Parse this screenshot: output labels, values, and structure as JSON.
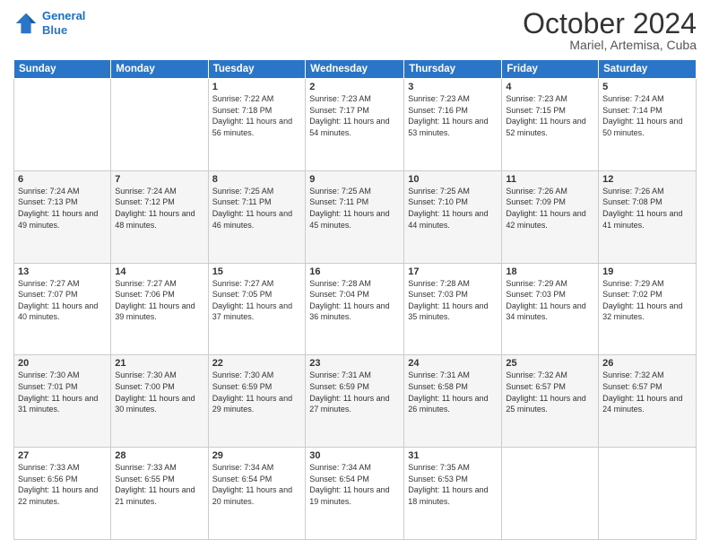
{
  "header": {
    "logo_line1": "General",
    "logo_line2": "Blue",
    "month": "October 2024",
    "location": "Mariel, Artemisa, Cuba"
  },
  "weekdays": [
    "Sunday",
    "Monday",
    "Tuesday",
    "Wednesday",
    "Thursday",
    "Friday",
    "Saturday"
  ],
  "weeks": [
    [
      {
        "day": "",
        "sunrise": "",
        "sunset": "",
        "daylight": ""
      },
      {
        "day": "",
        "sunrise": "",
        "sunset": "",
        "daylight": ""
      },
      {
        "day": "1",
        "sunrise": "Sunrise: 7:22 AM",
        "sunset": "Sunset: 7:18 PM",
        "daylight": "Daylight: 11 hours and 56 minutes."
      },
      {
        "day": "2",
        "sunrise": "Sunrise: 7:23 AM",
        "sunset": "Sunset: 7:17 PM",
        "daylight": "Daylight: 11 hours and 54 minutes."
      },
      {
        "day": "3",
        "sunrise": "Sunrise: 7:23 AM",
        "sunset": "Sunset: 7:16 PM",
        "daylight": "Daylight: 11 hours and 53 minutes."
      },
      {
        "day": "4",
        "sunrise": "Sunrise: 7:23 AM",
        "sunset": "Sunset: 7:15 PM",
        "daylight": "Daylight: 11 hours and 52 minutes."
      },
      {
        "day": "5",
        "sunrise": "Sunrise: 7:24 AM",
        "sunset": "Sunset: 7:14 PM",
        "daylight": "Daylight: 11 hours and 50 minutes."
      }
    ],
    [
      {
        "day": "6",
        "sunrise": "Sunrise: 7:24 AM",
        "sunset": "Sunset: 7:13 PM",
        "daylight": "Daylight: 11 hours and 49 minutes."
      },
      {
        "day": "7",
        "sunrise": "Sunrise: 7:24 AM",
        "sunset": "Sunset: 7:12 PM",
        "daylight": "Daylight: 11 hours and 48 minutes."
      },
      {
        "day": "8",
        "sunrise": "Sunrise: 7:25 AM",
        "sunset": "Sunset: 7:11 PM",
        "daylight": "Daylight: 11 hours and 46 minutes."
      },
      {
        "day": "9",
        "sunrise": "Sunrise: 7:25 AM",
        "sunset": "Sunset: 7:11 PM",
        "daylight": "Daylight: 11 hours and 45 minutes."
      },
      {
        "day": "10",
        "sunrise": "Sunrise: 7:25 AM",
        "sunset": "Sunset: 7:10 PM",
        "daylight": "Daylight: 11 hours and 44 minutes."
      },
      {
        "day": "11",
        "sunrise": "Sunrise: 7:26 AM",
        "sunset": "Sunset: 7:09 PM",
        "daylight": "Daylight: 11 hours and 42 minutes."
      },
      {
        "day": "12",
        "sunrise": "Sunrise: 7:26 AM",
        "sunset": "Sunset: 7:08 PM",
        "daylight": "Daylight: 11 hours and 41 minutes."
      }
    ],
    [
      {
        "day": "13",
        "sunrise": "Sunrise: 7:27 AM",
        "sunset": "Sunset: 7:07 PM",
        "daylight": "Daylight: 11 hours and 40 minutes."
      },
      {
        "day": "14",
        "sunrise": "Sunrise: 7:27 AM",
        "sunset": "Sunset: 7:06 PM",
        "daylight": "Daylight: 11 hours and 39 minutes."
      },
      {
        "day": "15",
        "sunrise": "Sunrise: 7:27 AM",
        "sunset": "Sunset: 7:05 PM",
        "daylight": "Daylight: 11 hours and 37 minutes."
      },
      {
        "day": "16",
        "sunrise": "Sunrise: 7:28 AM",
        "sunset": "Sunset: 7:04 PM",
        "daylight": "Daylight: 11 hours and 36 minutes."
      },
      {
        "day": "17",
        "sunrise": "Sunrise: 7:28 AM",
        "sunset": "Sunset: 7:03 PM",
        "daylight": "Daylight: 11 hours and 35 minutes."
      },
      {
        "day": "18",
        "sunrise": "Sunrise: 7:29 AM",
        "sunset": "Sunset: 7:03 PM",
        "daylight": "Daylight: 11 hours and 34 minutes."
      },
      {
        "day": "19",
        "sunrise": "Sunrise: 7:29 AM",
        "sunset": "Sunset: 7:02 PM",
        "daylight": "Daylight: 11 hours and 32 minutes."
      }
    ],
    [
      {
        "day": "20",
        "sunrise": "Sunrise: 7:30 AM",
        "sunset": "Sunset: 7:01 PM",
        "daylight": "Daylight: 11 hours and 31 minutes."
      },
      {
        "day": "21",
        "sunrise": "Sunrise: 7:30 AM",
        "sunset": "Sunset: 7:00 PM",
        "daylight": "Daylight: 11 hours and 30 minutes."
      },
      {
        "day": "22",
        "sunrise": "Sunrise: 7:30 AM",
        "sunset": "Sunset: 6:59 PM",
        "daylight": "Daylight: 11 hours and 29 minutes."
      },
      {
        "day": "23",
        "sunrise": "Sunrise: 7:31 AM",
        "sunset": "Sunset: 6:59 PM",
        "daylight": "Daylight: 11 hours and 27 minutes."
      },
      {
        "day": "24",
        "sunrise": "Sunrise: 7:31 AM",
        "sunset": "Sunset: 6:58 PM",
        "daylight": "Daylight: 11 hours and 26 minutes."
      },
      {
        "day": "25",
        "sunrise": "Sunrise: 7:32 AM",
        "sunset": "Sunset: 6:57 PM",
        "daylight": "Daylight: 11 hours and 25 minutes."
      },
      {
        "day": "26",
        "sunrise": "Sunrise: 7:32 AM",
        "sunset": "Sunset: 6:57 PM",
        "daylight": "Daylight: 11 hours and 24 minutes."
      }
    ],
    [
      {
        "day": "27",
        "sunrise": "Sunrise: 7:33 AM",
        "sunset": "Sunset: 6:56 PM",
        "daylight": "Daylight: 11 hours and 22 minutes."
      },
      {
        "day": "28",
        "sunrise": "Sunrise: 7:33 AM",
        "sunset": "Sunset: 6:55 PM",
        "daylight": "Daylight: 11 hours and 21 minutes."
      },
      {
        "day": "29",
        "sunrise": "Sunrise: 7:34 AM",
        "sunset": "Sunset: 6:54 PM",
        "daylight": "Daylight: 11 hours and 20 minutes."
      },
      {
        "day": "30",
        "sunrise": "Sunrise: 7:34 AM",
        "sunset": "Sunset: 6:54 PM",
        "daylight": "Daylight: 11 hours and 19 minutes."
      },
      {
        "day": "31",
        "sunrise": "Sunrise: 7:35 AM",
        "sunset": "Sunset: 6:53 PM",
        "daylight": "Daylight: 11 hours and 18 minutes."
      },
      {
        "day": "",
        "sunrise": "",
        "sunset": "",
        "daylight": ""
      },
      {
        "day": "",
        "sunrise": "",
        "sunset": "",
        "daylight": ""
      }
    ]
  ]
}
